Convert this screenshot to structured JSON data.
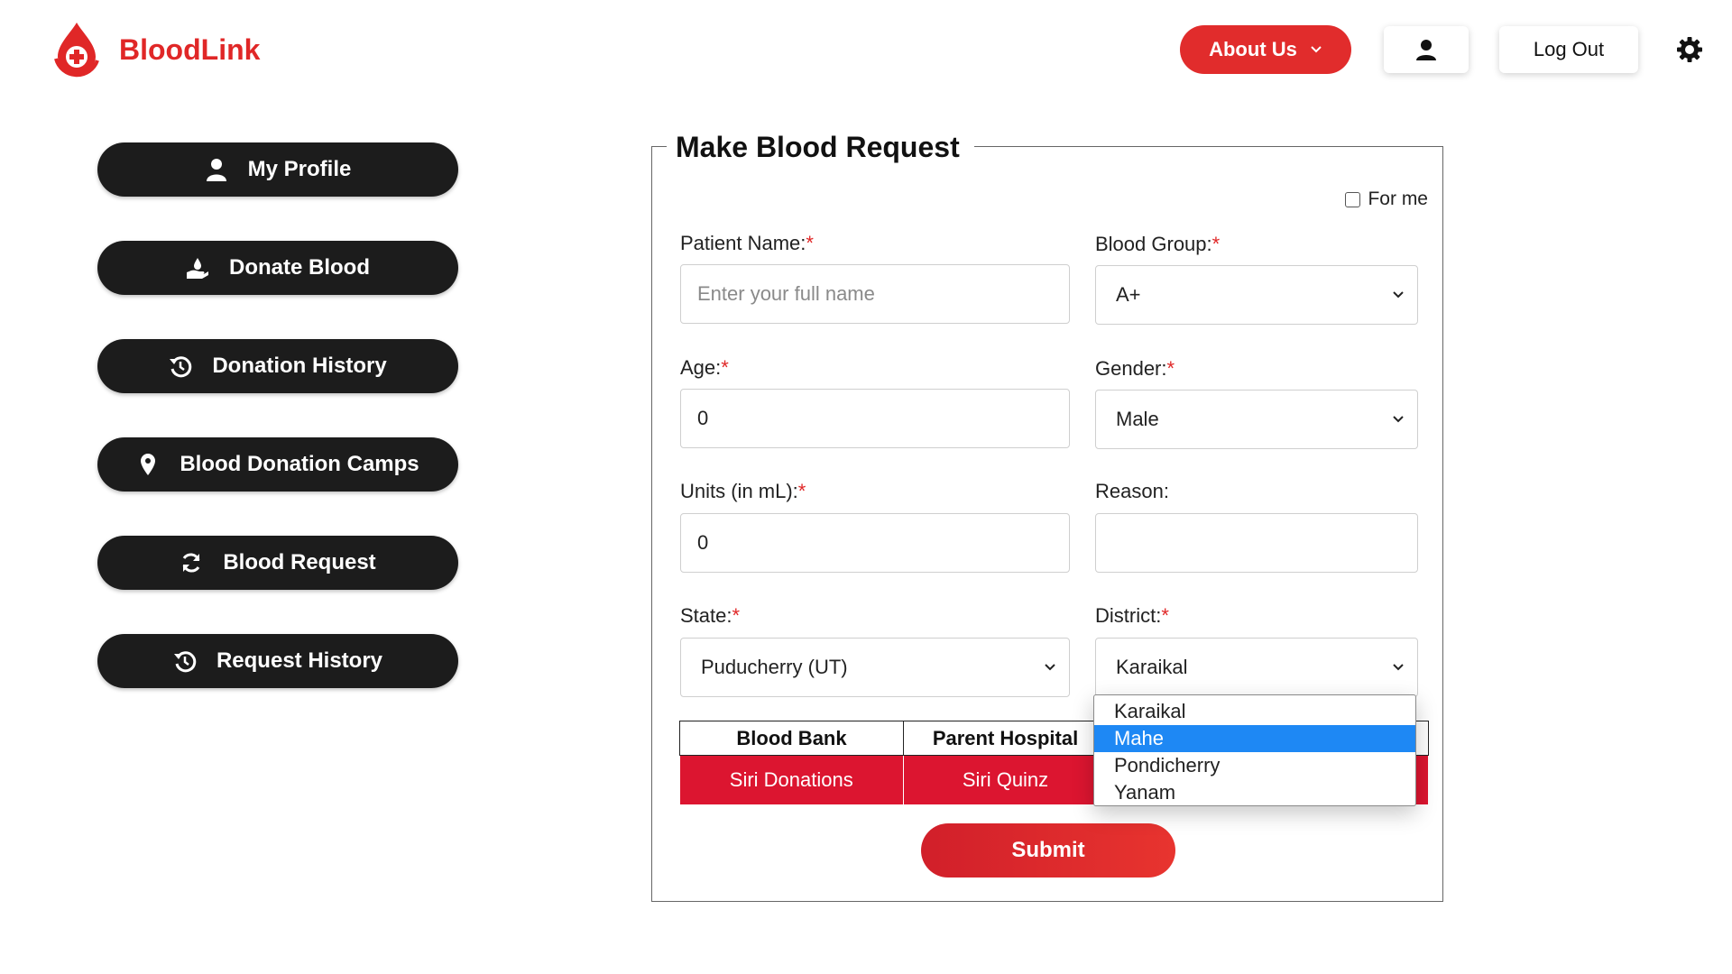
{
  "header": {
    "brand": "BloodLink",
    "about_label": "About Us",
    "logout_label": "Log Out"
  },
  "sidebar": {
    "items": [
      {
        "label": "My Profile",
        "icon": "user-icon"
      },
      {
        "label": "Donate Blood",
        "icon": "donate-hand-icon"
      },
      {
        "label": "Donation History",
        "icon": "history-icon"
      },
      {
        "label": "Blood Donation Camps",
        "icon": "location-pin-icon"
      },
      {
        "label": "Blood Request",
        "icon": "refresh-icon"
      },
      {
        "label": "Request History",
        "icon": "history-icon"
      }
    ]
  },
  "form": {
    "title": "Make Blood Request",
    "for_me_label": "For me",
    "for_me_checked": false,
    "patient_name": {
      "label": "Patient Name:",
      "required": "*",
      "placeholder": "Enter your full name",
      "value": ""
    },
    "blood_group": {
      "label": "Blood Group:",
      "required": "*",
      "value": "A+"
    },
    "age": {
      "label": "Age:",
      "required": "*",
      "value": "0"
    },
    "gender": {
      "label": "Gender:",
      "required": "*",
      "value": "Male"
    },
    "units": {
      "label": "Units (in mL):",
      "required": "*",
      "value": "0"
    },
    "reason": {
      "label": "Reason:",
      "value": ""
    },
    "state": {
      "label": "State:",
      "required": "*",
      "value": "Puducherry (UT)"
    },
    "district": {
      "label": "District:",
      "required": "*",
      "value": "Karaikal",
      "options": [
        "Karaikal",
        "Mahe",
        "Pondicherry",
        "Yanam"
      ],
      "highlighted": "Mahe"
    },
    "table": {
      "headers": [
        "Blood Bank",
        "Parent Hospital"
      ],
      "rows": [
        [
          "Siri Donations",
          "Siri Quinz"
        ]
      ]
    },
    "submit_label": "Submit"
  },
  "colors": {
    "brand": "#e02727",
    "sidebar_bg": "#1c1c1c",
    "table_row": "#dc1530",
    "dropdown_highlight": "#1e88f4"
  }
}
